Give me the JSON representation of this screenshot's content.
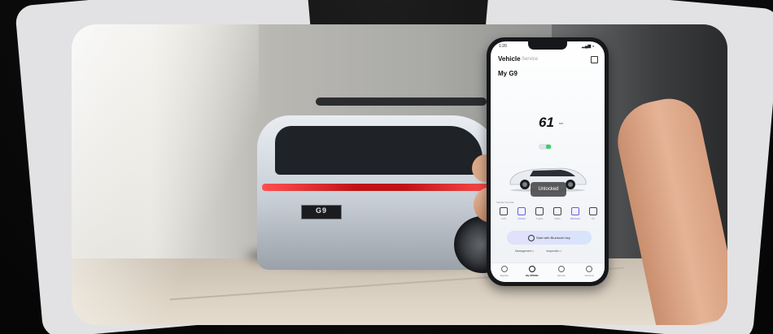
{
  "phone": {
    "time": "1:20",
    "status": "▂▄▆ ◒",
    "tabs": [
      "Vehicle",
      "Service"
    ],
    "model": "My G9",
    "range_value": "61",
    "range_unit": "km",
    "toast": "Unlocked",
    "controls_title": "Vehicle Controls",
    "controls": [
      {
        "label": "Lock",
        "active": false
      },
      {
        "label": "Unlock",
        "active": true
      },
      {
        "label": "T-gate",
        "active": false
      },
      {
        "label": "Flash",
        "active": false
      },
      {
        "label": "Windows",
        "active": true
      },
      {
        "label": "AC",
        "active": false
      }
    ],
    "bluetooth_button": "Start with Bluetooth key",
    "links": [
      "Management  >",
      "Inspection  >"
    ],
    "nav": [
      {
        "label": "Explore",
        "active": false
      },
      {
        "label": "My XPENG",
        "active": true
      },
      {
        "label": "Service",
        "active": false
      },
      {
        "label": "Account",
        "active": false
      }
    ]
  },
  "car": {
    "badge": "G9",
    "color": "#dfe4ea",
    "taillight_color": "#c01414"
  },
  "accent": "#6a5bdc"
}
